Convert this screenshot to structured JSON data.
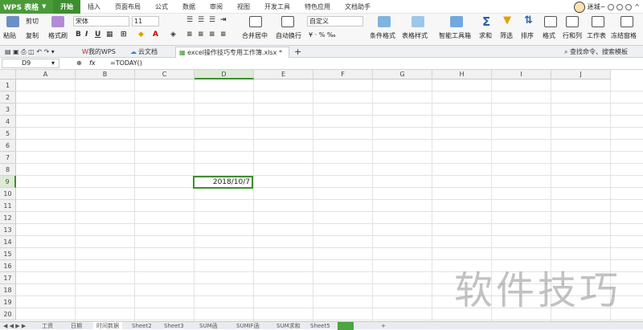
{
  "app": {
    "logo": "WPS 表格"
  },
  "menu_tabs": [
    "开始",
    "插入",
    "页面布局",
    "公式",
    "数据",
    "审阅",
    "视图",
    "开发工具",
    "特色应用",
    "文档助手"
  ],
  "user": {
    "name": "迷城~"
  },
  "ribbon": {
    "paste": "粘贴",
    "cut": "剪切",
    "copy": "复制",
    "format_painter": "格式刷",
    "font_name": "宋体",
    "font_size": "11",
    "merge_center": "合并居中",
    "wrap_text": "自动换行",
    "number_format": "自定义",
    "percent_sym": "¥ · % ‰",
    "conditional_format": "条件格式",
    "table_style": "表格样式",
    "smart_toolbox": "智能工具箱",
    "sum": "求和",
    "filter": "筛选",
    "sort": "排序",
    "format": "格式",
    "row_col": "行和列",
    "worksheet": "工作表",
    "freeze": "冻结窗格"
  },
  "doc_tabs": {
    "my_wps": "我的WPS",
    "cloud": "云文档",
    "file": "excel操作技巧专用工作簿.xlsx *",
    "search": "查找命令、搜索模板"
  },
  "formula_bar": {
    "name_box": "D9",
    "fx": "fx",
    "formula": "=TODAY()"
  },
  "columns": [
    "A",
    "B",
    "C",
    "D",
    "E",
    "F",
    "G",
    "H",
    "I",
    "J"
  ],
  "rows": [
    "1",
    "2",
    "3",
    "4",
    "5",
    "6",
    "7",
    "8",
    "9",
    "10",
    "11",
    "12",
    "13",
    "14",
    "15",
    "16",
    "17",
    "18",
    "19",
    "20"
  ],
  "active_cell": {
    "col": "D",
    "row": "9",
    "value": "2018/10/7"
  },
  "sheet_tabs": [
    "工资",
    "日期",
    "时间数据",
    "Sheet2",
    "Sheet3",
    "SUM函",
    "SUMIF函",
    "SUM求和",
    "Sheet5"
  ],
  "watermark": "软件技巧"
}
